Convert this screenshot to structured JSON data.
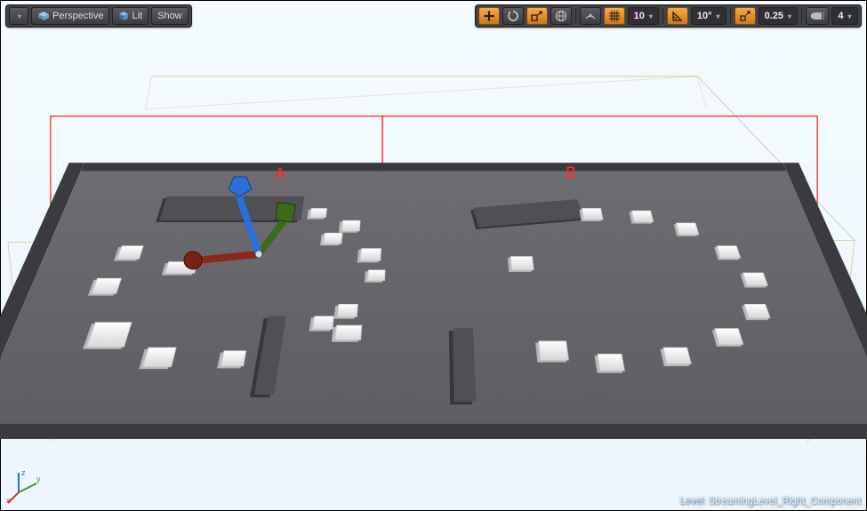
{
  "toolbar_left": {
    "menu_caret": "▾",
    "perspective_label": "Perspective",
    "lit_label": "Lit",
    "show_label": "Show"
  },
  "toolbar_right": {
    "grid_size": "10",
    "rotation_snap": "10°",
    "scale_snap": "0.25",
    "camera_speed": "4",
    "icons": {
      "translate": "translate-icon",
      "rotate": "rotate-icon",
      "scale": "scale-icon",
      "world_local": "world-local-icon",
      "surface_snap": "surface-snap-icon",
      "grid_snap": "grid-snap-icon",
      "angle_snap": "angle-snap-icon",
      "scale_snap_icon": "scale-snap-icon",
      "camera_speed_icon": "camera-speed-icon"
    }
  },
  "status": {
    "prefix": "Level:",
    "level_name": "StreamingLevel_Right_Component"
  },
  "axes": {
    "x": "x",
    "y": "y",
    "z": "z"
  },
  "annotations": {
    "region_a": "A",
    "region_b": "B"
  },
  "colors": {
    "accent_orange": "#e79336",
    "gizmo_x": "#c43a24",
    "gizmo_y": "#3f7a1f",
    "gizmo_z": "#2a6fdc",
    "volume_red": "#ff2a2a",
    "bounds_yellow": "#b7a23a"
  }
}
